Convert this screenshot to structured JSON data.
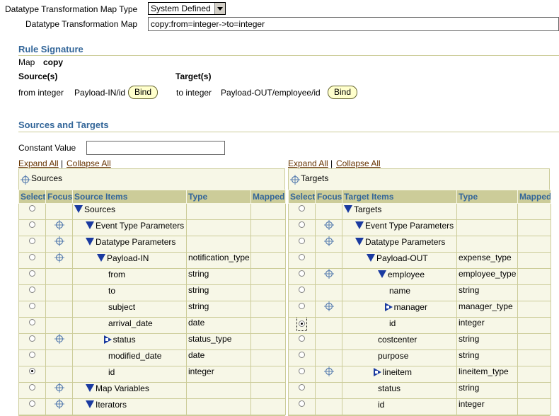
{
  "header": {
    "map_type_label": "Datatype Transformation Map Type",
    "map_type_value": "System Defined",
    "map_label": "Datatype Transformation Map",
    "map_value": "copy:from=integer->to=integer"
  },
  "rule_signature": {
    "title": "Rule Signature",
    "map_label": "Map",
    "map_value": "copy",
    "sources_label": "Source(s)",
    "targets_label": "Target(s)",
    "source_type": "from integer",
    "source_path": "Payload-IN/id",
    "target_type": "to integer",
    "target_path": "Payload-OUT/employee/id",
    "bind_label": "Bind"
  },
  "sources_targets": {
    "title": "Sources and Targets",
    "constant_label": "Constant Value",
    "constant_value": "",
    "expand_all": "Expand All",
    "collapse_all": "Collapse All",
    "separator": "|"
  },
  "sources_panel": {
    "title": "Sources",
    "columns": [
      "Select",
      "Focus",
      "Source Items",
      "Type",
      "Mapped"
    ],
    "rows": [
      {
        "label": "Sources",
        "type": "",
        "indent": 0,
        "expander": "down",
        "focus": false,
        "checked": false
      },
      {
        "label": "Event Type Parameters",
        "type": "",
        "indent": 1,
        "expander": "down",
        "focus": true,
        "checked": false
      },
      {
        "label": "Datatype Parameters",
        "type": "",
        "indent": 1,
        "expander": "down",
        "focus": true,
        "checked": false
      },
      {
        "label": "Payload-IN",
        "type": "notification_type",
        "indent": 2,
        "expander": "down",
        "focus": true,
        "checked": false
      },
      {
        "label": "from",
        "type": "string",
        "indent": 3,
        "expander": "",
        "focus": false,
        "checked": false
      },
      {
        "label": "to",
        "type": "string",
        "indent": 3,
        "expander": "",
        "focus": false,
        "checked": false
      },
      {
        "label": "subject",
        "type": "string",
        "indent": 3,
        "expander": "",
        "focus": false,
        "checked": false
      },
      {
        "label": "arrival_date",
        "type": "date",
        "indent": 3,
        "expander": "",
        "focus": false,
        "checked": false
      },
      {
        "label": "status",
        "type": "status_type",
        "indent": 2.6,
        "expander": "right",
        "focus": true,
        "checked": false
      },
      {
        "label": "modified_date",
        "type": "date",
        "indent": 3,
        "expander": "",
        "focus": false,
        "checked": false
      },
      {
        "label": "id",
        "type": "integer",
        "indent": 3,
        "expander": "",
        "focus": false,
        "checked": true
      },
      {
        "label": "Map Variables",
        "type": "",
        "indent": 1,
        "expander": "down",
        "focus": true,
        "checked": false
      },
      {
        "label": "Iterators",
        "type": "",
        "indent": 1,
        "expander": "down",
        "focus": true,
        "checked": false
      }
    ]
  },
  "targets_panel": {
    "title": "Targets",
    "columns": [
      "Select",
      "Focus",
      "Target Items",
      "Type",
      "Mapped"
    ],
    "rows": [
      {
        "label": "Targets",
        "type": "",
        "indent": 0,
        "expander": "down",
        "focus": false,
        "checked": false
      },
      {
        "label": "Event Type Parameters",
        "type": "",
        "indent": 1,
        "expander": "down",
        "focus": true,
        "checked": false
      },
      {
        "label": "Datatype Parameters",
        "type": "",
        "indent": 1,
        "expander": "down",
        "focus": true,
        "checked": false
      },
      {
        "label": "Payload-OUT",
        "type": "expense_type",
        "indent": 2,
        "expander": "down",
        "focus": false,
        "checked": false
      },
      {
        "label": "employee",
        "type": "employee_type",
        "indent": 3,
        "expander": "down",
        "focus": true,
        "checked": false
      },
      {
        "label": "name",
        "type": "string",
        "indent": 4,
        "expander": "",
        "focus": false,
        "checked": false
      },
      {
        "label": "manager",
        "type": "manager_type",
        "indent": 3.6,
        "expander": "right",
        "focus": true,
        "checked": false
      },
      {
        "label": "id",
        "type": "integer",
        "indent": 4,
        "expander": "",
        "focus": false,
        "checked": true,
        "focused": true
      },
      {
        "label": "costcenter",
        "type": "string",
        "indent": 3,
        "expander": "",
        "focus": false,
        "checked": false
      },
      {
        "label": "purpose",
        "type": "string",
        "indent": 3,
        "expander": "",
        "focus": false,
        "checked": false
      },
      {
        "label": "lineitem",
        "type": "lineitem_type",
        "indent": 2.6,
        "expander": "right",
        "focus": true,
        "checked": false
      },
      {
        "label": "status",
        "type": "string",
        "indent": 3,
        "expander": "",
        "focus": false,
        "checked": false
      },
      {
        "label": "id",
        "type": "integer",
        "indent": 3,
        "expander": "",
        "focus": false,
        "checked": false
      }
    ]
  },
  "colors": {
    "section_title": "#336699",
    "table_header_bg": "#cccc99",
    "panel_bg": "#f7f7e7",
    "link": "#663300",
    "tree_icon": "#1a3aa0"
  }
}
